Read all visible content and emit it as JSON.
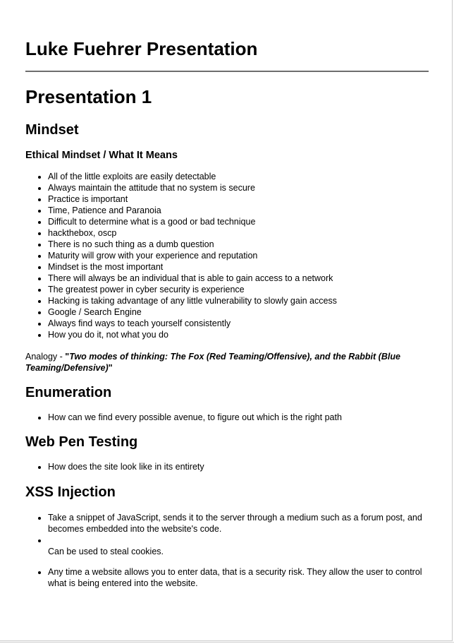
{
  "document": {
    "title": "Luke Fuehrer Presentation",
    "section_title": "Presentation 1"
  },
  "mindset": {
    "heading": "Mindset",
    "subheading": "Ethical Mindset / What It Means",
    "items": [
      "All of the little exploits are easily detectable",
      "Always maintain the attitude that no system is secure",
      "Practice is important",
      "Time, Patience and Paranoia",
      "Difficult to determine what is a good or bad technique",
      "hackthebox, oscp",
      "There is no such thing as a dumb question",
      "Maturity will grow with your experience and reputation",
      "Mindset is the most important",
      "There will always be an individual that is able to gain access to a network",
      "The greatest power in cyber security is experience",
      "Hacking is taking advantage of any little vulnerability to slowly gain access",
      "Google / Search Engine",
      "Always find ways to teach yourself consistently",
      "How you do it, not what you do"
    ],
    "analogy_prefix": "Analogy - ",
    "analogy_open_quote": "\"",
    "analogy_quote": "Two modes of thinking: The Fox (Red Teaming/Offensive), and the Rabbit (Blue Teaming/Defensive)",
    "analogy_close_quote": "\""
  },
  "enumeration": {
    "heading": "Enumeration",
    "items": [
      "How can we find every possible avenue, to figure out which is the right path"
    ]
  },
  "web_pen_testing": {
    "heading": "Web Pen Testing",
    "items": [
      "How does the site look like in its entirety"
    ]
  },
  "xss_injection": {
    "heading": "XSS Injection",
    "items": [
      "Take a snippet of JavaScript, sends it to the server through a medium such as a forum post, and becomes embedded into the website's code.",
      "",
      "Any time a website allows you to enter data, that is a security risk. They allow the user to control what is being entered into the website."
    ],
    "sub_paragraph": "Can be used to steal cookies."
  }
}
